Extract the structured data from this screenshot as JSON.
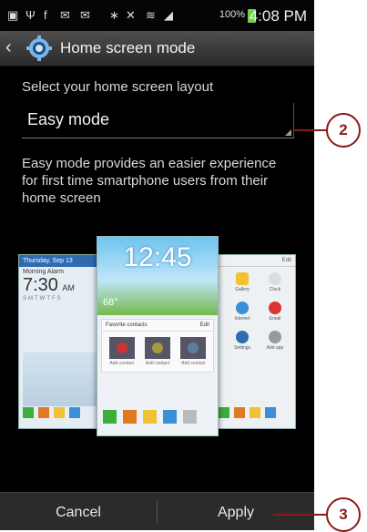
{
  "status_bar": {
    "time": "4:08 PM",
    "battery": "100%"
  },
  "header": {
    "title": "Home screen mode"
  },
  "layout_setting": {
    "label": "Select your home screen layout",
    "selected_value": "Easy mode",
    "description": "Easy mode provides an easier experience for first time smartphone users from their home screen"
  },
  "preview": {
    "left_card": {
      "date": "Thursday, Sep 13",
      "alarm_label": "Morning Alarm",
      "alarm_time": "7:30",
      "alarm_ampm": "AM",
      "weekdays": "SMTWTFS"
    },
    "center_card": {
      "clock": "12:45",
      "temp": "68°",
      "favorites_label": "Favorite contacts",
      "edit_label": "Edit",
      "add_contact": "Add contact"
    },
    "right_card": {
      "edit_label": "Edit",
      "apps": [
        "Gallery",
        "Clock",
        "Internet",
        "Email",
        "Settings",
        "Add app"
      ]
    }
  },
  "bottom_bar": {
    "cancel_label": "Cancel",
    "apply_label": "Apply"
  },
  "callouts": {
    "dropdown": "2",
    "apply": "3"
  },
  "colors": {
    "callout": "#8b1a1a",
    "accent_blue": "#3a8fd8"
  }
}
